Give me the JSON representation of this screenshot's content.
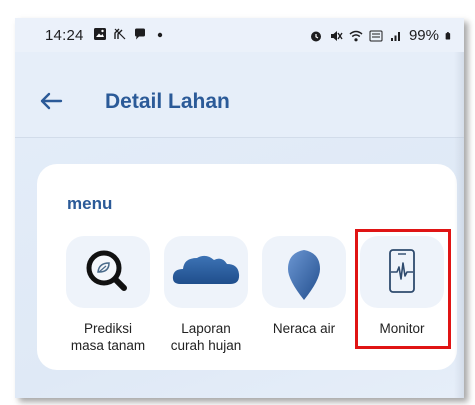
{
  "status_bar": {
    "time": "14:24",
    "battery": "99%",
    "icons_left": [
      "gallery-icon",
      "muted-notification-icon",
      "chat-bubble-icon",
      "dot-icon"
    ],
    "icons_right": [
      "alarm-icon",
      "mute-icon",
      "wifi-icon",
      "volte-icon",
      "signal-icon",
      "battery-icon"
    ]
  },
  "app_bar": {
    "title": "Detail Lahan",
    "back_icon": "arrow-left-icon"
  },
  "menu": {
    "title": "menu",
    "items": [
      {
        "label": "Prediksi\nmasa tanam",
        "icon": "magnifier-leaf-icon"
      },
      {
        "label": "Laporan\ncurah hujan",
        "icon": "cloud-icon"
      },
      {
        "label": "Neraca air",
        "icon": "water-drop-icon"
      },
      {
        "label": "Monitor",
        "icon": "phone-pulse-icon"
      }
    ],
    "highlighted_item": "Monitor"
  },
  "colors": {
    "accent": "#2b5a98",
    "highlight": "#e01414",
    "background": "#e4edf8",
    "tile": "#eef3fa"
  }
}
